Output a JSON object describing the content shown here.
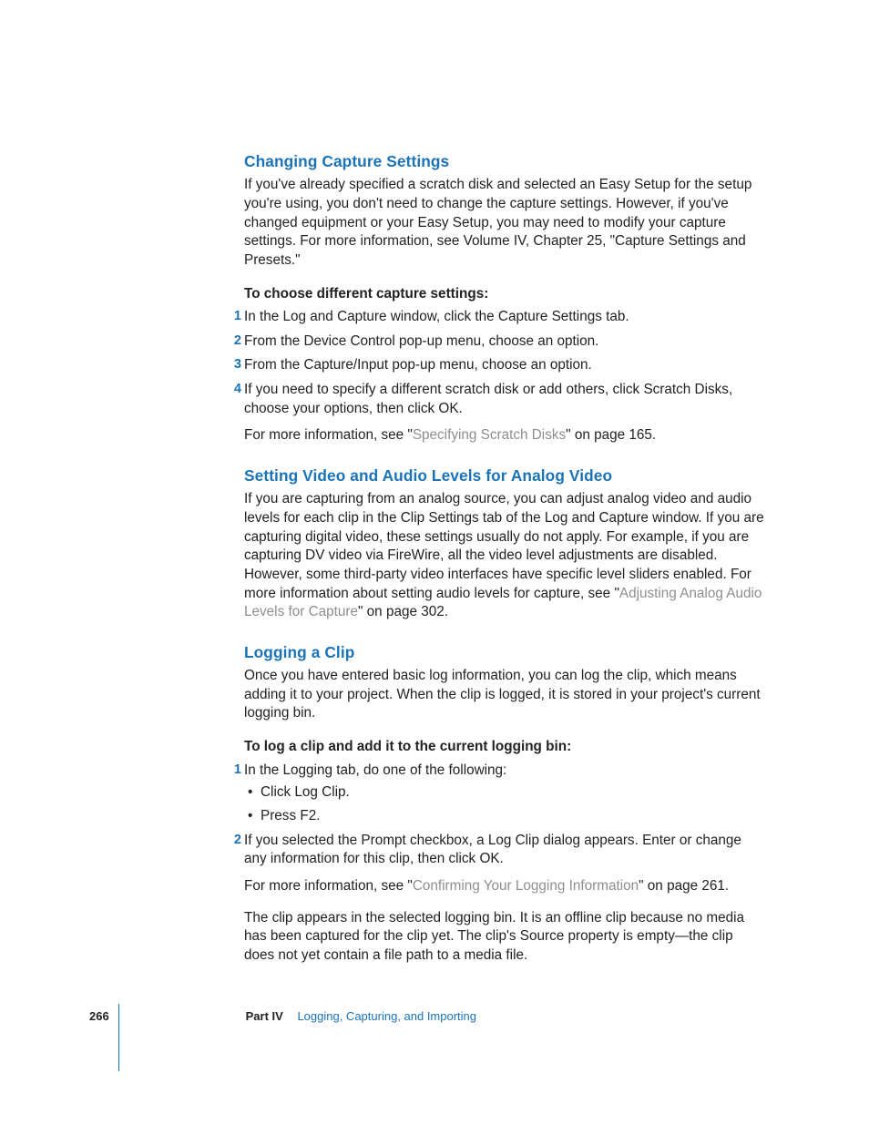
{
  "sections": {
    "capture": {
      "heading": "Changing Capture Settings",
      "para": "If you've already specified a scratch disk and selected an Easy Setup for the setup you're using, you don't need to change the capture settings. However, if you've changed equipment or your Easy Setup, you may need to modify your capture settings. For more information, see Volume IV, Chapter 25, \"Capture Settings and Presets.\"",
      "subhead": "To choose different capture settings:",
      "steps": {
        "s1": "In the Log and Capture window, click the Capture Settings tab.",
        "s2": "From the Device Control pop-up menu, choose an option.",
        "s3": "From the Capture/Input pop-up menu, choose an option.",
        "s4": "If you need to specify a different scratch disk or add others, click Scratch Disks, choose your options, then click OK."
      },
      "moreinfo_pre": "For more information, see \"",
      "moreinfo_link": "Specifying Scratch Disks",
      "moreinfo_post": "\" on page 165."
    },
    "levels": {
      "heading": "Setting Video and Audio Levels for Analog Video",
      "para_pre": "If you are capturing from an analog source, you can adjust analog video and audio levels for each clip in the Clip Settings tab of the Log and Capture window. If you are capturing digital video, these settings usually do not apply. For example, if you are capturing DV video via FireWire, all the video level adjustments are disabled. However, some third-party video interfaces have specific level sliders enabled. For more information about setting audio levels for capture, see \"",
      "para_link": "Adjusting Analog Audio Levels for Capture",
      "para_post": "\" on page 302."
    },
    "logging": {
      "heading": "Logging a Clip",
      "para": "Once you have entered basic log information, you can log the clip, which means adding it to your project. When the clip is logged, it is stored in your project's current logging bin.",
      "subhead": "To log a clip and add it to the current logging bin:",
      "step1_intro": "In the Logging tab, do one of the following:",
      "bullets": {
        "b1": "Click Log Clip.",
        "b2": "Press F2."
      },
      "step2": "If you selected the Prompt checkbox, a Log Clip dialog appears. Enter or change any information for this clip, then click OK.",
      "moreinfo_pre": "For more information, see \"",
      "moreinfo_link": "Confirming Your Logging Information",
      "moreinfo_post": "\" on page 261.",
      "trailing": "The clip appears in the selected logging bin. It is an offline clip because no media has been captured for the clip yet. The clip's Source property is empty—the clip does not yet contain a file path to a media file."
    }
  },
  "nums": {
    "n1": "1",
    "n2": "2",
    "n3": "3",
    "n4": "4"
  },
  "footer": {
    "page": "266",
    "part_label": "Part IV",
    "part_title": "Logging, Capturing, and Importing"
  }
}
